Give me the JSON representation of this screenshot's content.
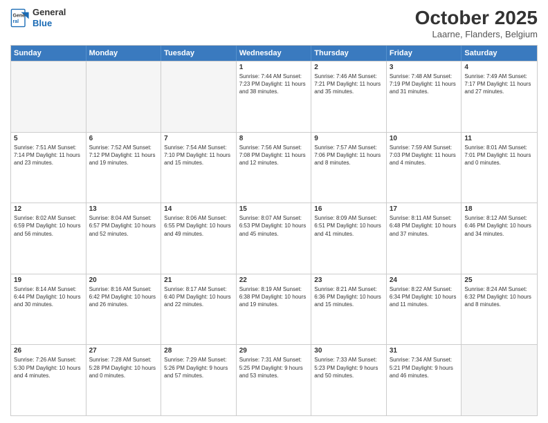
{
  "header": {
    "title": "October 2025",
    "subtitle": "Laarne, Flanders, Belgium",
    "logo_line1": "General",
    "logo_line2": "Blue"
  },
  "days": [
    "Sunday",
    "Monday",
    "Tuesday",
    "Wednesday",
    "Thursday",
    "Friday",
    "Saturday"
  ],
  "weeks": [
    [
      {
        "num": "",
        "info": ""
      },
      {
        "num": "",
        "info": ""
      },
      {
        "num": "",
        "info": ""
      },
      {
        "num": "1",
        "info": "Sunrise: 7:44 AM\nSunset: 7:23 PM\nDaylight: 11 hours\nand 38 minutes."
      },
      {
        "num": "2",
        "info": "Sunrise: 7:46 AM\nSunset: 7:21 PM\nDaylight: 11 hours\nand 35 minutes."
      },
      {
        "num": "3",
        "info": "Sunrise: 7:48 AM\nSunset: 7:19 PM\nDaylight: 11 hours\nand 31 minutes."
      },
      {
        "num": "4",
        "info": "Sunrise: 7:49 AM\nSunset: 7:17 PM\nDaylight: 11 hours\nand 27 minutes."
      }
    ],
    [
      {
        "num": "5",
        "info": "Sunrise: 7:51 AM\nSunset: 7:14 PM\nDaylight: 11 hours\nand 23 minutes."
      },
      {
        "num": "6",
        "info": "Sunrise: 7:52 AM\nSunset: 7:12 PM\nDaylight: 11 hours\nand 19 minutes."
      },
      {
        "num": "7",
        "info": "Sunrise: 7:54 AM\nSunset: 7:10 PM\nDaylight: 11 hours\nand 15 minutes."
      },
      {
        "num": "8",
        "info": "Sunrise: 7:56 AM\nSunset: 7:08 PM\nDaylight: 11 hours\nand 12 minutes."
      },
      {
        "num": "9",
        "info": "Sunrise: 7:57 AM\nSunset: 7:06 PM\nDaylight: 11 hours\nand 8 minutes."
      },
      {
        "num": "10",
        "info": "Sunrise: 7:59 AM\nSunset: 7:03 PM\nDaylight: 11 hours\nand 4 minutes."
      },
      {
        "num": "11",
        "info": "Sunrise: 8:01 AM\nSunset: 7:01 PM\nDaylight: 11 hours\nand 0 minutes."
      }
    ],
    [
      {
        "num": "12",
        "info": "Sunrise: 8:02 AM\nSunset: 6:59 PM\nDaylight: 10 hours\nand 56 minutes."
      },
      {
        "num": "13",
        "info": "Sunrise: 8:04 AM\nSunset: 6:57 PM\nDaylight: 10 hours\nand 52 minutes."
      },
      {
        "num": "14",
        "info": "Sunrise: 8:06 AM\nSunset: 6:55 PM\nDaylight: 10 hours\nand 49 minutes."
      },
      {
        "num": "15",
        "info": "Sunrise: 8:07 AM\nSunset: 6:53 PM\nDaylight: 10 hours\nand 45 minutes."
      },
      {
        "num": "16",
        "info": "Sunrise: 8:09 AM\nSunset: 6:51 PM\nDaylight: 10 hours\nand 41 minutes."
      },
      {
        "num": "17",
        "info": "Sunrise: 8:11 AM\nSunset: 6:48 PM\nDaylight: 10 hours\nand 37 minutes."
      },
      {
        "num": "18",
        "info": "Sunrise: 8:12 AM\nSunset: 6:46 PM\nDaylight: 10 hours\nand 34 minutes."
      }
    ],
    [
      {
        "num": "19",
        "info": "Sunrise: 8:14 AM\nSunset: 6:44 PM\nDaylight: 10 hours\nand 30 minutes."
      },
      {
        "num": "20",
        "info": "Sunrise: 8:16 AM\nSunset: 6:42 PM\nDaylight: 10 hours\nand 26 minutes."
      },
      {
        "num": "21",
        "info": "Sunrise: 8:17 AM\nSunset: 6:40 PM\nDaylight: 10 hours\nand 22 minutes."
      },
      {
        "num": "22",
        "info": "Sunrise: 8:19 AM\nSunset: 6:38 PM\nDaylight: 10 hours\nand 19 minutes."
      },
      {
        "num": "23",
        "info": "Sunrise: 8:21 AM\nSunset: 6:36 PM\nDaylight: 10 hours\nand 15 minutes."
      },
      {
        "num": "24",
        "info": "Sunrise: 8:22 AM\nSunset: 6:34 PM\nDaylight: 10 hours\nand 11 minutes."
      },
      {
        "num": "25",
        "info": "Sunrise: 8:24 AM\nSunset: 6:32 PM\nDaylight: 10 hours\nand 8 minutes."
      }
    ],
    [
      {
        "num": "26",
        "info": "Sunrise: 7:26 AM\nSunset: 5:30 PM\nDaylight: 10 hours\nand 4 minutes."
      },
      {
        "num": "27",
        "info": "Sunrise: 7:28 AM\nSunset: 5:28 PM\nDaylight: 10 hours\nand 0 minutes."
      },
      {
        "num": "28",
        "info": "Sunrise: 7:29 AM\nSunset: 5:26 PM\nDaylight: 9 hours\nand 57 minutes."
      },
      {
        "num": "29",
        "info": "Sunrise: 7:31 AM\nSunset: 5:25 PM\nDaylight: 9 hours\nand 53 minutes."
      },
      {
        "num": "30",
        "info": "Sunrise: 7:33 AM\nSunset: 5:23 PM\nDaylight: 9 hours\nand 50 minutes."
      },
      {
        "num": "31",
        "info": "Sunrise: 7:34 AM\nSunset: 5:21 PM\nDaylight: 9 hours\nand 46 minutes."
      },
      {
        "num": "",
        "info": ""
      }
    ]
  ]
}
